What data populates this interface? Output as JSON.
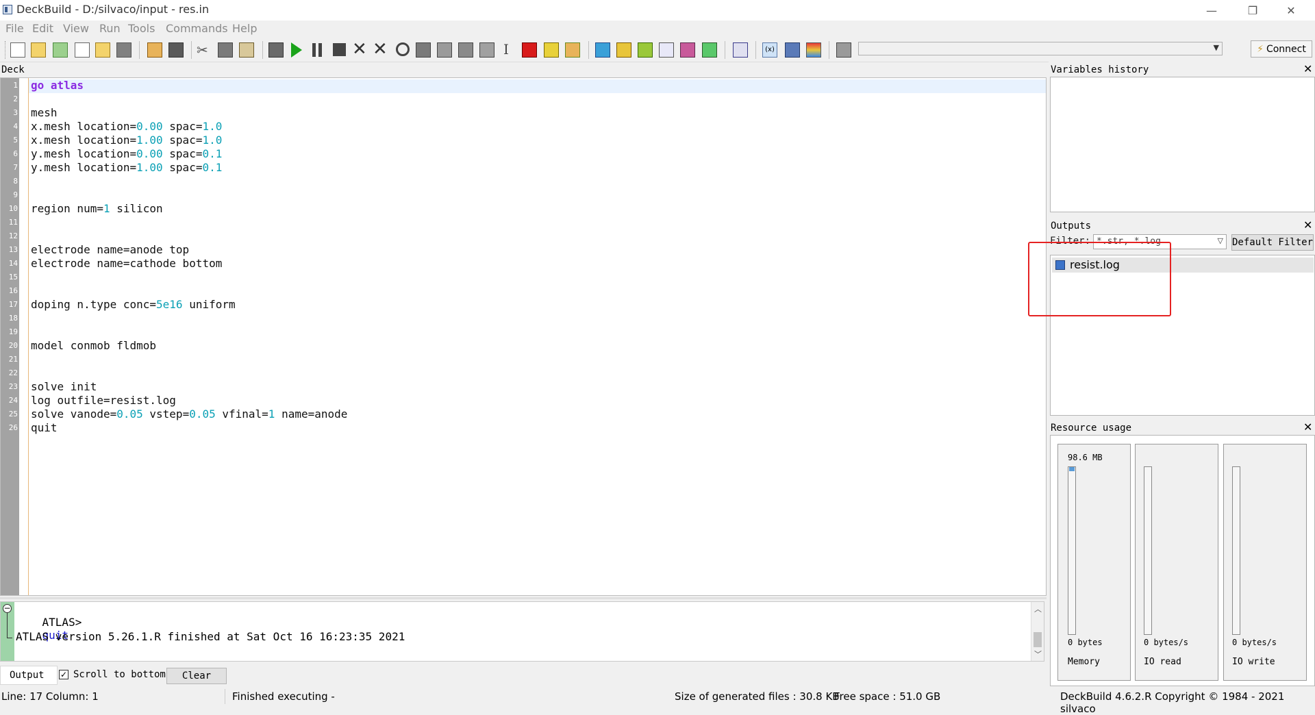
{
  "window": {
    "title": "DeckBuild - D:/silvaco/input - res.in",
    "controls": {
      "minimize": "—",
      "restore": "❐",
      "close": "✕"
    }
  },
  "menu": [
    "File",
    "Edit",
    "View",
    "Run",
    "Tools",
    "Commands",
    "Help"
  ],
  "toolbar": {
    "connect_label": "Connect",
    "combo_value": ""
  },
  "deck": {
    "header": "Deck",
    "line_numbers": [
      "1",
      "2",
      "3",
      "4",
      "5",
      "6",
      "7",
      "8",
      "9",
      "10",
      "11",
      "12",
      "13",
      "14",
      "15",
      "16",
      "17",
      "18",
      "19",
      "20",
      "21",
      "22",
      "23",
      "24",
      "25",
      "26"
    ],
    "lines": [
      "go atlas",
      "",
      "mesh",
      "x.mesh location=0.00 spac=1.0",
      "x.mesh location=1.00 spac=1.0",
      "y.mesh location=0.00 spac=0.1",
      "y.mesh location=1.00 spac=0.1",
      "",
      "",
      "region num=1 silicon",
      "",
      "",
      "electrode name=anode top",
      "electrode name=cathode bottom",
      "",
      "",
      "doping n.type conc=5e16 uniform",
      "",
      "",
      "model conmob fldmob",
      "",
      "",
      "solve init",
      "log outfile=resist.log",
      "solve vanode=0.05 vstep=0.05 vfinal=1 name=anode",
      "quit"
    ]
  },
  "console": {
    "prompt": "ATLAS>",
    "command": "quit",
    "message": "ATLAS version 5.26.1.R finished at Sat Oct 16 16:23:35 2021"
  },
  "output_tabs": {
    "output_label": "Output",
    "scroll_label": "Scroll to bottom",
    "scroll_checked": true,
    "clear_label": "Clear"
  },
  "variables_history": {
    "title": "Variables history"
  },
  "outputs": {
    "title": "Outputs",
    "filter_label": "Filter:",
    "filter_value": "*.str, *.log",
    "default_filter_label": "Default Filter",
    "files": [
      "resist.log"
    ]
  },
  "resource_usage": {
    "title": "Resource usage",
    "meters": [
      {
        "top_value": "98.6 MB",
        "bottom_value": "0 bytes",
        "label": "Memory"
      },
      {
        "top_value": "",
        "bottom_value": "0 bytes/s",
        "label": "IO read"
      },
      {
        "top_value": "",
        "bottom_value": "0 bytes/s",
        "label": "IO write"
      }
    ]
  },
  "status": {
    "position": "Line: 17 Column: 1",
    "state": "Finished executing -",
    "generated": "Size of generated files : 30.8 KB",
    "free_space": "Free space : 51.0 GB",
    "version": "DeckBuild 4.6.2.R  Copyright © 1984 - 2021 silvaco"
  },
  "colors": {
    "highlight_box": "#e52222",
    "keyword": "#8b2be2",
    "number": "#0aa0b5",
    "console_command": "#1a1acc"
  }
}
